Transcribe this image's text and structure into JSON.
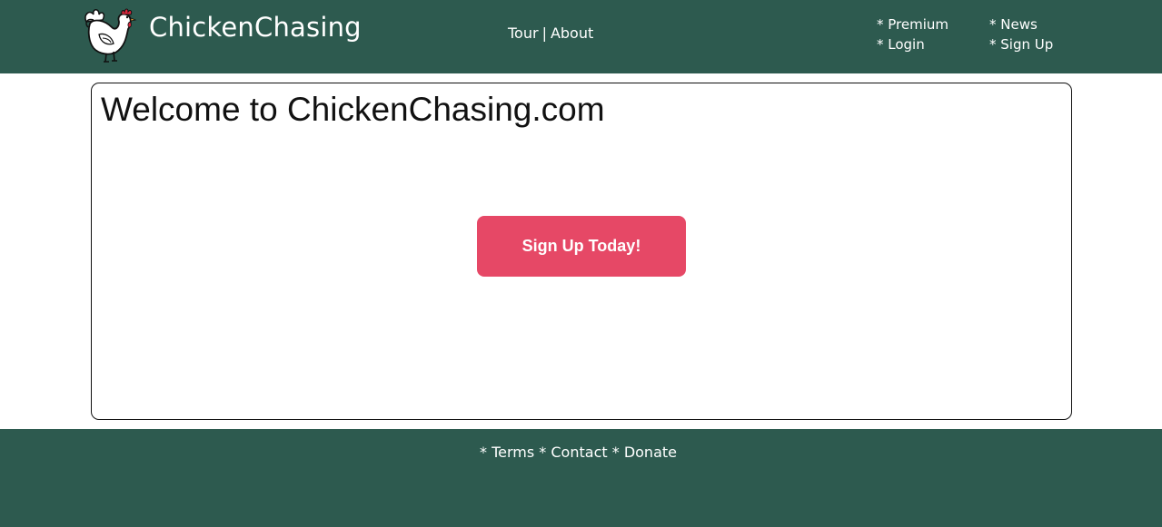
{
  "header": {
    "brand": "ChickenChasing",
    "logo_icon": "chicken-icon",
    "center_nav": {
      "tour": "Tour",
      "separator": "|",
      "about": "About"
    },
    "right_nav": {
      "premium": "* Premium",
      "login": "* Login",
      "news": "* News",
      "signup": "* Sign Up"
    }
  },
  "main": {
    "title": "Welcome to ChickenChasing.com",
    "cta_label": "Sign Up Today!"
  },
  "footer": {
    "terms": "* Terms",
    "contact": "* Contact",
    "donate": "* Donate"
  },
  "colors": {
    "header_bg": "#2d5a4f",
    "cta_bg": "#e64866",
    "text_light": "#ffffff"
  }
}
